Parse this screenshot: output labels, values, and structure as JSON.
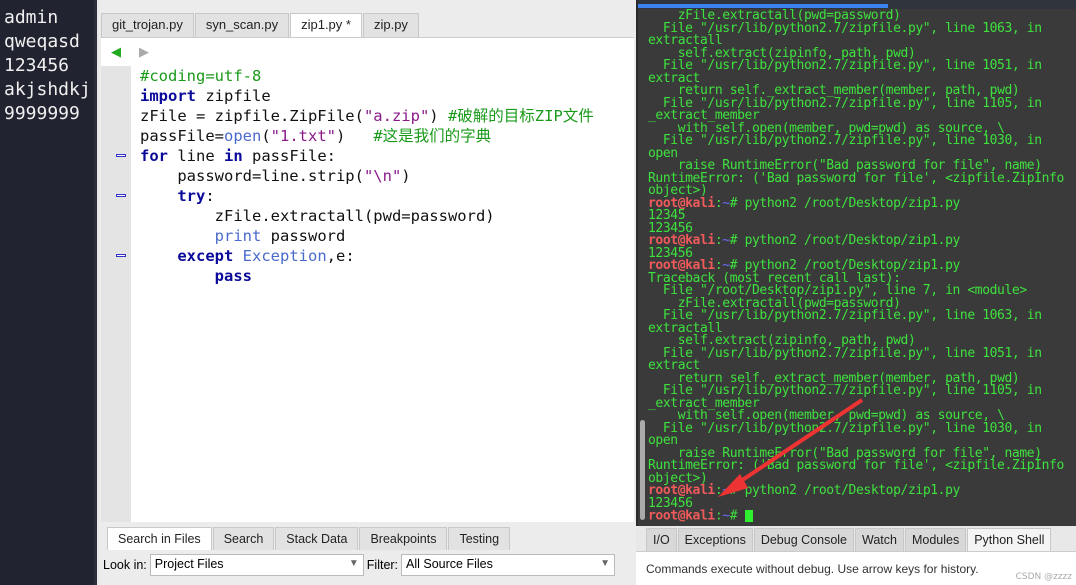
{
  "dictionary_panel": {
    "lines": [
      "admin",
      "qweqasd",
      "123456",
      "akjshdkj",
      "9999999"
    ]
  },
  "editor": {
    "tabs": [
      "git_trojan.py",
      "syn_scan.py",
      "zip1.py *",
      "zip.py"
    ],
    "active_tab": "zip1.py *",
    "code": {
      "l1": "#coding=utf-8",
      "l2_kw": "import",
      "l2": " zipfile",
      "l3a": "zFile = zipfile.ZipFile(",
      "l3s": "\"a.zip\"",
      "l3b": ") ",
      "l3c": "#破解的目标ZIP文件",
      "l4a": "passFile=",
      "l4b": "open",
      "l4c": "(",
      "l4s": "\"1.txt\"",
      "l4d": ")   ",
      "l4e": "#这是我们的字典",
      "l5a": "for",
      "l5b": " line ",
      "l5c": "in",
      "l5d": " passFile:",
      "l6a": "    password=line.strip(",
      "l6s": "\"\\n\"",
      "l6b": ")",
      "l7a": "    ",
      "l7b": "try",
      ":": ":",
      "l8": "        zFile.extractall(pwd=password)",
      "l9a": "        ",
      "l9b": "print",
      "l9c": " password",
      "l10a": "    ",
      "l10b": "except",
      "l10c": " ",
      "l10d": "Exception",
      ",e": ",e:",
      "l11a": "        ",
      "l11b": "pass"
    }
  },
  "search_panel": {
    "tabs": [
      "Search in Files",
      "Search",
      "Stack Data",
      "Breakpoints",
      "Testing"
    ],
    "look_in_label": "Look in:",
    "look_in_value": "Project Files",
    "filter_label": "Filter:",
    "filter_value": "All Source Files"
  },
  "debug_tabs": [
    "I/O",
    "Exceptions",
    "Debug Console",
    "Watch",
    "Modules",
    "Python Shell"
  ],
  "shell_hint": "Commands execute without debug.  Use arrow keys for history.",
  "watermark": "CSDN @zzzz",
  "terminal": {
    "prompt_user": "root@kali",
    "prompt_sep": ":",
    "prompt_dir": "~",
    "prompt_hash": "# ",
    "command": "python2 /root/Desktop/zip1.py",
    "lines": [
      "    zFile.extractall(pwd=password)",
      "  File \"/usr/lib/python2.7/zipfile.py\", line 1063, in extractall",
      "    self.extract(zipinfo, path, pwd)",
      "  File \"/usr/lib/python2.7/zipfile.py\", line 1051, in extract",
      "    return self._extract_member(member, path, pwd)",
      "  File \"/usr/lib/python2.7/zipfile.py\", line 1105, in _extract_member",
      "    with self.open(member, pwd=pwd) as source, \\",
      "  File \"/usr/lib/python2.7/zipfile.py\", line 1030, in open",
      "    raise RuntimeError(\"Bad password for file\", name)",
      "RuntimeError: ('Bad password for file', <zipfile.ZipInfo object>)",
      "$PROMPT",
      "12345",
      "123456",
      "$PROMPT",
      "123456",
      "$PROMPT",
      "Traceback (most recent call last):",
      "  File \"/root/Desktop/zip1.py\", line 7, in <module>",
      "    zFile.extractall(pwd=password)",
      "  File \"/usr/lib/python2.7/zipfile.py\", line 1063, in extractall",
      "    self.extract(zipinfo, path, pwd)",
      "  File \"/usr/lib/python2.7/zipfile.py\", line 1051, in extract",
      "    return self._extract_member(member, path, pwd)",
      "  File \"/usr/lib/python2.7/zipfile.py\", line 1105, in _extract_member",
      "    with self.open(member, pwd=pwd) as source, \\",
      "  File \"/usr/lib/python2.7/zipfile.py\", line 1030, in open",
      "    raise RuntimeError(\"Bad password for file\", name)",
      "RuntimeError: ('Bad password for file', <zipfile.ZipInfo object>)",
      "$PROMPT",
      "123456",
      "$CURSOR"
    ]
  },
  "colors": {
    "terminal_text": "#3ee23e",
    "prompt": "#f05a5a",
    "annotation_arrow": "#ee3333"
  }
}
